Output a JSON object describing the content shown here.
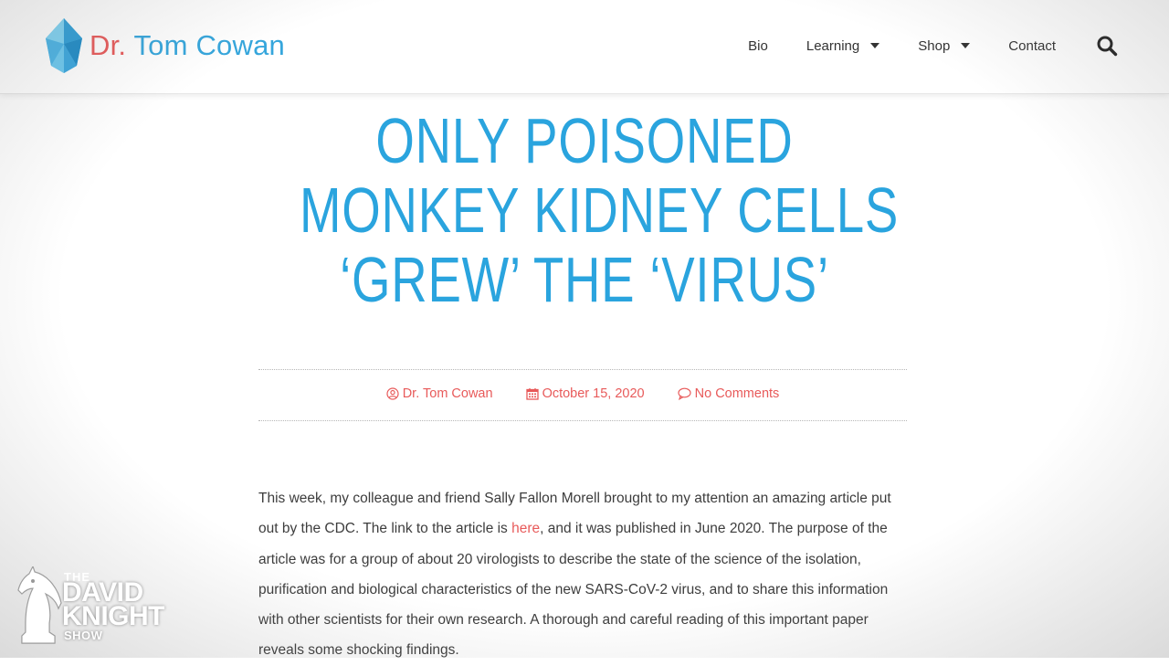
{
  "header": {
    "logo": {
      "dr": "Dr.",
      "name": "Tom Cowan"
    },
    "nav": [
      {
        "label": "Bio"
      },
      {
        "label": "Learning"
      },
      {
        "label": "Shop"
      },
      {
        "label": "Contact"
      }
    ]
  },
  "article": {
    "title_lines": [
      "ONLY POISONED",
      "MONKEY KIDNEY CELLS",
      "‘GREW’ THE ‘VIRUS’"
    ],
    "meta": {
      "author": "Dr. Tom Cowan",
      "date": "October 15, 2020",
      "comments": "No Comments"
    },
    "body": {
      "part1": "This week, my colleague and friend Sally Fallon Morell brought to my attention an amazing article put out by the CDC.  The link to the article is ",
      "link": "here",
      "part2": ",  and it was published in June 2020.  The purpose of the article was for a group of about 20 virologists to describe the state of the science of the isolation, purification and biological characteristics of the new SARS-CoV-2 virus, and to share this information with other scientists for their own research. A thorough and careful reading of this important paper reveals some shocking findings."
    }
  },
  "watermark": {
    "the": "THE",
    "line1": "DAVID",
    "line2": "KNIGHT",
    "line3": "SHOW"
  },
  "colors": {
    "accent_red": "#e85a5a",
    "title_blue": "#2aa4de",
    "logo_blue": "#36a6dc"
  }
}
